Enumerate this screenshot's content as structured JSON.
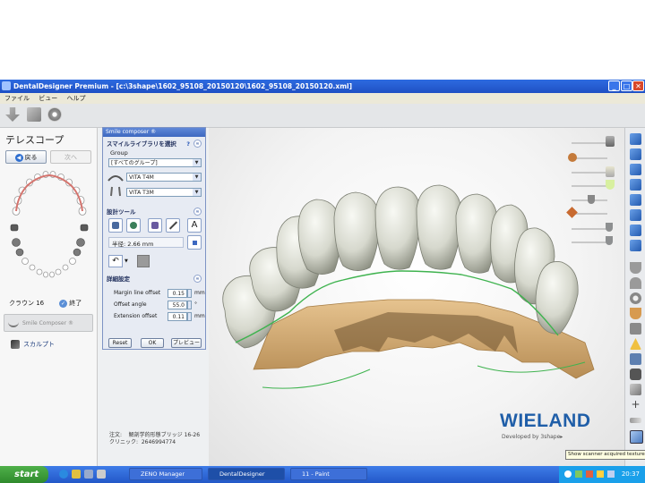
{
  "window": {
    "title": "DentalDesigner Premium - [c:\\3shape\\1602_95108_20150120\\1602_95108_20150120.xml]",
    "min_glyph": "_",
    "max_glyph": "□",
    "close_glyph": "✕"
  },
  "menu": [
    "ファイル",
    "ビュー",
    "ヘルプ"
  ],
  "left_panel": {
    "title": "テレスコープ",
    "back_label": "戻る",
    "next_label": "次へ",
    "crown_label": "クラウン 16",
    "finish_label": "終了",
    "smile_composer_label": "Smile Composer ®",
    "sculpt_label": "スカルプト"
  },
  "dialog": {
    "title": "Smile composer ®",
    "library_section": "スマイルライブラリを選択",
    "help_glyph": "?",
    "collapse_glyph": "≈",
    "group_label": "Group",
    "group_value": "[すべてのグループ]",
    "lib1_value": "VITA T4M",
    "lib2_value": "VITA T3M",
    "design_tools_section": "設計ツール",
    "tool_text_glyph": "A",
    "radius_label": "半径: 2.66 mm",
    "undo_glyph": "↶",
    "detail_section": "詳細設定",
    "params": [
      {
        "label": "Margin line offset",
        "value": "0.15",
        "unit": "mm"
      },
      {
        "label": "Offset angle",
        "value": "55.0",
        "unit": "°"
      },
      {
        "label": "Extension offset",
        "value": "0.11",
        "unit": "mm"
      }
    ],
    "reset_label": "Reset",
    "ok_label": "OK",
    "preview_label": "プレビュー"
  },
  "viewport": {
    "order_label": "注文:",
    "order_value": "解剖学的形態ブリッジ 16-26",
    "clinic_label": "クリニック:",
    "clinic_value": "2646994774",
    "brand": "WIELAND",
    "developed_by": "Developed by 3shape▸"
  },
  "tooltip": "Show scanner acquired texture",
  "taskbar": {
    "start_label": "start",
    "tasks": [
      "ZENO Manager",
      "DentalDesigner",
      "11 - Paint"
    ],
    "clock": "20:37"
  },
  "colors": {
    "title_bar": "#2d6be0",
    "accent": "#3d68c0",
    "brand": "#1f5ea8",
    "tooth": "#dfe1d6",
    "gum_model": "#d8b583",
    "margin_line": "#3fb34f"
  },
  "icons": {
    "right_toolbar": [
      "box-view-icon",
      "box-view-icon",
      "box-view-icon",
      "box-view-icon",
      "box-view-icon",
      "box-view-icon",
      "box-view-icon",
      "box-view-icon",
      "tooth-gray-icon",
      "tooth-gray-icon",
      "gear-icon",
      "tooth-orange-icon",
      "tooth-gray-icon",
      "warning-icon",
      "screen-icon",
      "camera-icon",
      "cube-icon",
      "cross-icon",
      "ruler-icon",
      "texture-icon"
    ]
  }
}
